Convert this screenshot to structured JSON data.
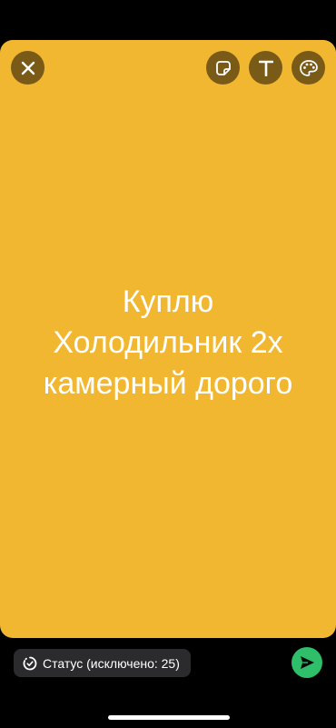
{
  "canvas": {
    "background_color": "#F2B731",
    "text": "Куплю\nХолодильник 2х\nкамерный дорого"
  },
  "toolbar": {
    "close_icon": "close-icon",
    "sticker_icon": "sticker-icon",
    "text_icon": "text-icon",
    "palette_icon": "palette-icon"
  },
  "footer": {
    "privacy_label": "Статус (исключено: 25)",
    "send_icon": "send-icon",
    "send_color": "#2FBE6A"
  }
}
